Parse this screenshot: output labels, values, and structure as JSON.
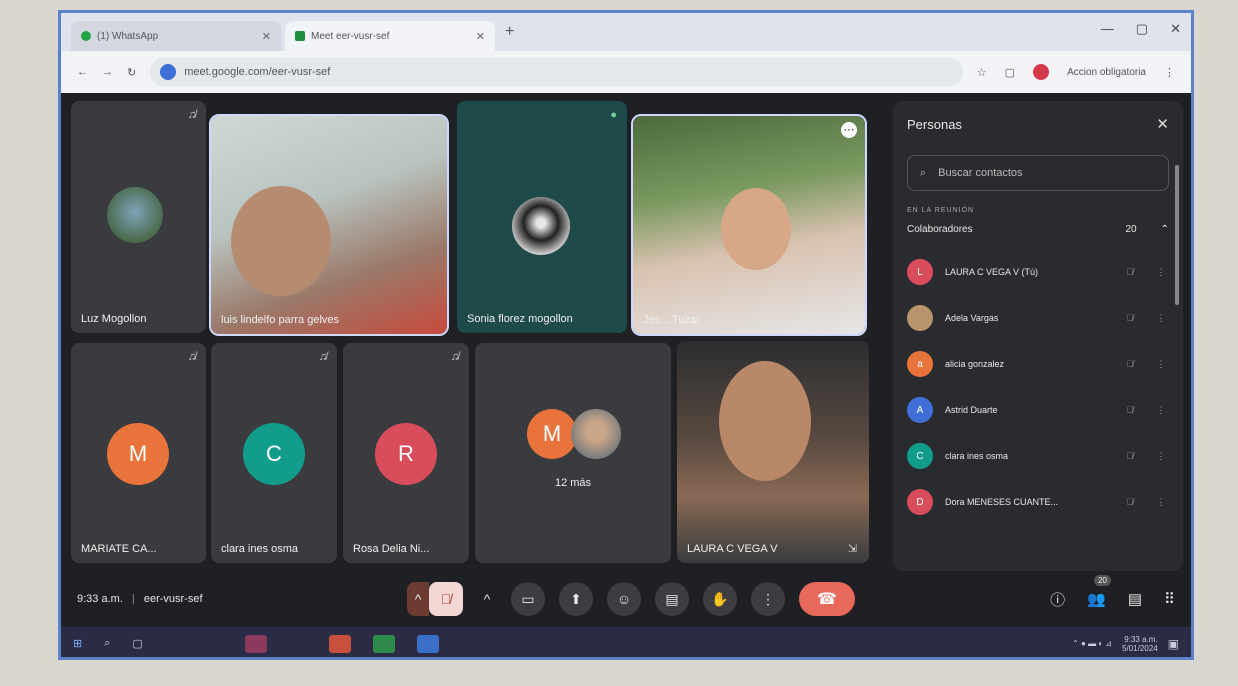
{
  "browser": {
    "tabs": [
      {
        "label": "(1) WhatsApp",
        "active": false,
        "color": "#25a244"
      },
      {
        "label": "Meet eer-vusr-sef",
        "active": true,
        "color": "#1e8e3e"
      }
    ],
    "url": "meet.google.com/eer-vusr-sef",
    "profile_label": "Accion obligatoria"
  },
  "tiles": [
    {
      "name": "Luz Mogollon",
      "type": "avatar-photo"
    },
    {
      "name": "luis lindelfo parra gelves",
      "type": "video"
    },
    {
      "name": "Sonia florez mogollon",
      "type": "avatar-photo"
    },
    {
      "name": "Jes... Tuzar",
      "type": "video"
    },
    {
      "name": "MARIATE CA...",
      "type": "initial",
      "initial": "M",
      "color": "#e8743b"
    },
    {
      "name": "clara ines osma",
      "type": "initial",
      "initial": "C",
      "color": "#129c8c"
    },
    {
      "name": "Rosa Delia Ni...",
      "type": "initial",
      "initial": "R",
      "color": "#d94c5c"
    },
    {
      "name": "12 más",
      "type": "more",
      "initial": "M",
      "color": "#e8743b"
    },
    {
      "name": "LAURA C VEGA V",
      "type": "video"
    }
  ],
  "meeting": {
    "time": "9:33 a.m.",
    "separator": "|",
    "code": "eer-vusr-sef",
    "people_count": "20"
  },
  "panel": {
    "title": "Personas",
    "search_placeholder": "Buscar contactos",
    "section_label": "EN LA REUNIÓN",
    "group_label": "Colaboradores",
    "group_count": "20",
    "people": [
      {
        "name": "LAURA C VEGA V (Tú)",
        "initial": "L",
        "color": "#d94c5c"
      },
      {
        "name": "Adela Vargas",
        "initial": "",
        "color": "#b8946a"
      },
      {
        "name": "alicia gonzalez",
        "initial": "a",
        "color": "#e8743b"
      },
      {
        "name": "Astrid Duarte",
        "initial": "A",
        "color": "#3f6fd6"
      },
      {
        "name": "clara ines osma",
        "initial": "C",
        "color": "#129c8c"
      },
      {
        "name": "Dora MENESES CUANTE...",
        "initial": "D",
        "color": "#d94c5c"
      }
    ]
  },
  "taskbar": {
    "clock_time": "9:33 a.m.",
    "clock_date": "5/01/2024"
  }
}
